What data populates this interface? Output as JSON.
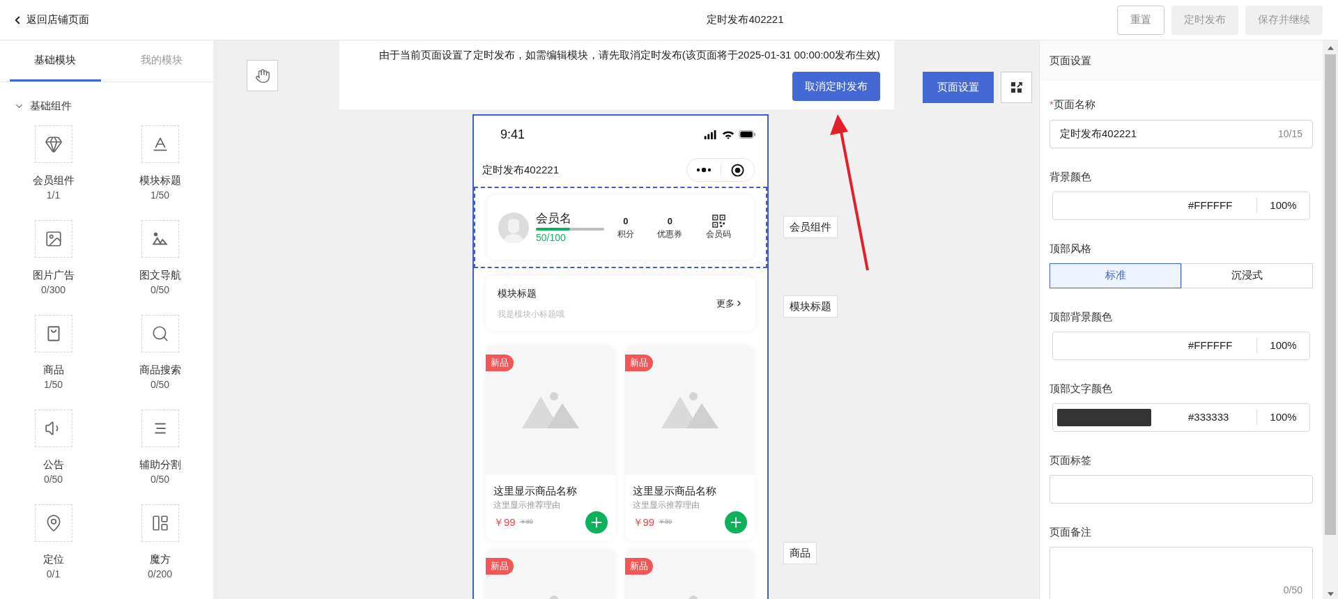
{
  "header": {
    "back": "返回店铺页面",
    "title": "定时发布402221",
    "buttons": [
      {
        "label": "重置",
        "disabled": false
      },
      {
        "label": "定时发布",
        "disabled": true
      },
      {
        "label": "保存并继续",
        "disabled": true
      }
    ]
  },
  "left_panel": {
    "tabs": [
      {
        "label": "基础模块",
        "selected": true
      },
      {
        "label": "我的模块",
        "selected": false
      }
    ],
    "group": {
      "title": "基础组件",
      "expanded": true
    },
    "components": [
      {
        "name": "会员组件",
        "count": "1/1"
      },
      {
        "name": "模块标题",
        "count": "1/50"
      },
      {
        "name": "图片广告",
        "count": "0/300"
      },
      {
        "name": "图文导航",
        "count": "0/50"
      },
      {
        "name": "商品",
        "count": "1/50"
      },
      {
        "name": "商品搜索",
        "count": "0/50"
      },
      {
        "name": "公告",
        "count": "0/50"
      },
      {
        "name": "辅助分割",
        "count": "0/50"
      },
      {
        "name": "定位",
        "count": "0/1"
      },
      {
        "name": "魔方",
        "count": "0/200"
      }
    ]
  },
  "notice": {
    "text": "由于当前页面设置了定时发布，如需编辑模块，请先取消定时发布(该页面将于2025-01-31 00:00:00发布生效)",
    "button": "取消定时发布"
  },
  "canvas": {
    "page_settings_button": "页面设置",
    "side_labels": [
      "会员组件",
      "模块标题",
      "商品"
    ]
  },
  "phone": {
    "time": "9:41",
    "title": "定时发布402221",
    "member": {
      "name": "会员名",
      "level": 0.5,
      "progress": "50/100",
      "stats": [
        {
          "value": "0",
          "label": "积分"
        },
        {
          "value": "0",
          "label": "优惠券"
        }
      ],
      "code_label": "会员码"
    },
    "module": {
      "title": "模块标题",
      "subtitle": "我是模块小标题哦",
      "more": "更多"
    },
    "products": [
      {
        "badge": "新品",
        "name": "这里显示商品名称",
        "reason": "这里显示推荐理由",
        "price": "￥99",
        "original_price": "￥89"
      },
      {
        "badge": "新品",
        "name": "这里显示商品名称",
        "reason": "这里显示推荐理由",
        "price": "￥99",
        "original_price": "￥89"
      },
      {
        "badge": "新品"
      },
      {
        "badge": "新品"
      }
    ]
  },
  "right_panel": {
    "title": "页面设置",
    "fields": [
      {
        "kind": "text",
        "label": "页面名称",
        "required_mark": "*",
        "value": "定时发布402221",
        "counter": "10/15"
      },
      {
        "kind": "color",
        "label": "背景颜色",
        "hex": "#FFFFFF",
        "opacity": "100%"
      },
      {
        "kind": "segmented",
        "label": "顶部风格",
        "options": [
          {
            "label": "标准",
            "selected": true
          },
          {
            "label": "沉浸式",
            "selected": false
          }
        ]
      },
      {
        "kind": "color",
        "label": "顶部背景颜色",
        "hex": "#FFFFFF",
        "opacity": "100%"
      },
      {
        "kind": "color",
        "label": "顶部文字颜色",
        "color": "#333333",
        "hex": "#333333",
        "opacity": "100%"
      },
      {
        "kind": "text",
        "label": "页面标签"
      },
      {
        "kind": "textarea",
        "label": "页面备注",
        "counter": "0/50"
      }
    ]
  }
}
